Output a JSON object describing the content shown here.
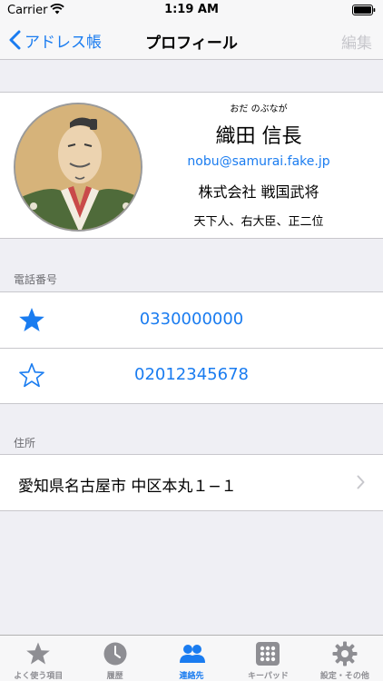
{
  "status_bar": {
    "carrier": "Carrier",
    "time": "1:19 AM"
  },
  "nav": {
    "back_label": "アドレス帳",
    "title": "プロフィール",
    "edit_label": "編集"
  },
  "profile": {
    "furigana": "おだ のぶなが",
    "name": "織田 信長",
    "email": "nobu@samurai.fake.jp",
    "company": "株式会社 戦国武将",
    "title": "天下人、右大臣、正二位"
  },
  "phone_section": {
    "header": "電話番号",
    "items": [
      {
        "number": "0330000000",
        "icon": "star-filled-icon"
      },
      {
        "number": "02012345678",
        "icon": "star-outline-icon"
      }
    ]
  },
  "address_section": {
    "header": "住所",
    "address": "愛知県名古屋市 中区本丸１−１"
  },
  "tab_bar": {
    "tabs": [
      {
        "label": "よく使う項目",
        "icon": "star-icon"
      },
      {
        "label": "履歴",
        "icon": "clock-icon"
      },
      {
        "label": "連絡先",
        "icon": "contacts-icon",
        "active": true
      },
      {
        "label": "キーパッド",
        "icon": "keypad-icon"
      },
      {
        "label": "設定・その他",
        "icon": "gear-icon"
      }
    ]
  },
  "colors": {
    "accent": "#1a7cf0",
    "inactive": "#8e8e93",
    "background": "#efeff4"
  }
}
